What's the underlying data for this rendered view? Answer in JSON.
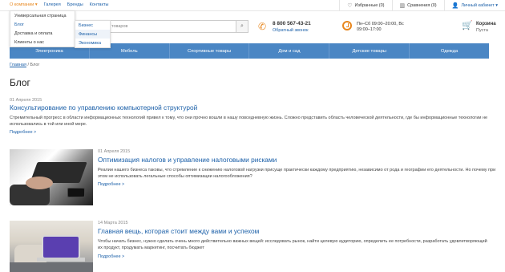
{
  "topnav": {
    "items": [
      "О компании ▾",
      "Галерея",
      "Бренды",
      "Контакты"
    ]
  },
  "topbar_right": {
    "favorites": "Избранные (0)",
    "compare": "Сравнения (0)",
    "account": "Личный кабинет ▾"
  },
  "dropdown_company": [
    "Универсальная страница",
    "Блог",
    "Доставка и оплата",
    "Клиенты о нас"
  ],
  "dropdown_blog": [
    "Бизнес",
    "Финансы",
    "Экономика"
  ],
  "search": {
    "placeholder": "товаров"
  },
  "phone": {
    "number": "8 800 567-43-21",
    "callback": "Обратный звонок"
  },
  "hours": {
    "line1": "Пн–Сб 09:00–20:00, Вс",
    "line2": "09:00–17:00"
  },
  "cart": {
    "title": "Корзина",
    "status": "Пуста"
  },
  "categories": [
    "Электроника",
    "Мебель",
    "Спортивные товары",
    "Дом и сад",
    "Детские товары",
    "Одежда"
  ],
  "breadcrumb": {
    "home": "Главная",
    "separator": " / ",
    "current": "Блог"
  },
  "page_title": "Блог",
  "posts": [
    {
      "date": "01 Апреля 2015",
      "title": "Консультирование по управлению компьютерной структурой",
      "excerpt": "Стремительный прогресс в области информационных технологий привел к тому, что они прочно вошли в нашу повседневную жизнь. Сложно представить область человеческой деятельности, где бы информационные технологии не использовались в той или иной мере.",
      "more": "Подробнее >"
    },
    {
      "date": "01 Апреля 2015",
      "title": "Оптимизация налогов и управление налоговыми рисками",
      "excerpt": "Реалии нашего бизнеса таковы, что стремление к снижению налоговой нагрузки присуще практически каждому предприятию, независимо от рода и географии его деятельности. Но почему при этом не использовать легальные способы оптимизации налогообложения?",
      "more": "Подробнее >"
    },
    {
      "date": "14 Марта 2015",
      "title": "Главная вещь, которая стоит между вами и успехом",
      "excerpt": "Чтобы начать бизнес, нужно сделать очень много действительно важных вещей: исследовать рынок, найти целевую аудиторию, определить ее потребности, разработать удовлетворяющий их продукт, продумать маркетинг, посчитать бюджет",
      "more": "Подробнее >"
    }
  ],
  "colors": {
    "accent": "#e8871e",
    "link": "#1a5fa8",
    "category_bar": "#4a86c4"
  }
}
